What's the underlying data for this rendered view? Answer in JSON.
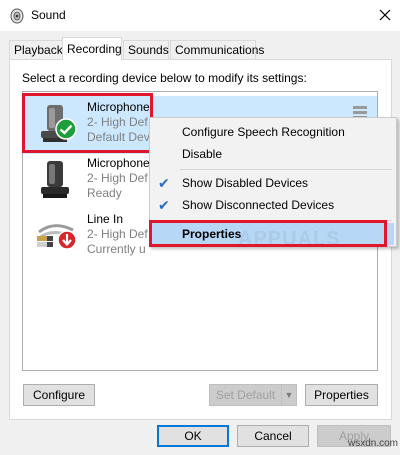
{
  "window": {
    "title": "Sound"
  },
  "tabs": [
    {
      "label": "Playback"
    },
    {
      "label": "Recording"
    },
    {
      "label": "Sounds"
    },
    {
      "label": "Communications"
    }
  ],
  "instruction": "Select a recording device below to modify its settings:",
  "devices": [
    {
      "name": "Microphone",
      "line2": "2- High Def",
      "line3": "Default Dev",
      "status": "default"
    },
    {
      "name": "Microphone",
      "line2": "2- High Def",
      "line3": "Ready",
      "status": "ready"
    },
    {
      "name": "Line In",
      "line2": "2- High Def",
      "line3": "Currently u",
      "status": "unplugged"
    }
  ],
  "context_menu": {
    "items": [
      {
        "label": "Configure Speech Recognition",
        "checked": false
      },
      {
        "label": "Disable",
        "checked": false
      },
      {
        "label": "Show Disabled Devices",
        "checked": true
      },
      {
        "label": "Show Disconnected Devices",
        "checked": true
      },
      {
        "label": "Properties",
        "checked": false,
        "active": true
      }
    ]
  },
  "buttons": {
    "configure": "Configure",
    "set_default": "Set Default",
    "properties": "Properties",
    "ok": "OK",
    "cancel": "Cancel",
    "apply": "Apply"
  },
  "watermark": "APPUALS",
  "site_label": "wsxdn.com",
  "colors": {
    "selection": "#cce8ff",
    "highlight_red": "#e0162b",
    "accent_blue": "#0078d7",
    "check_green": "#1e9e3a",
    "unplug_red": "#d9262c"
  }
}
